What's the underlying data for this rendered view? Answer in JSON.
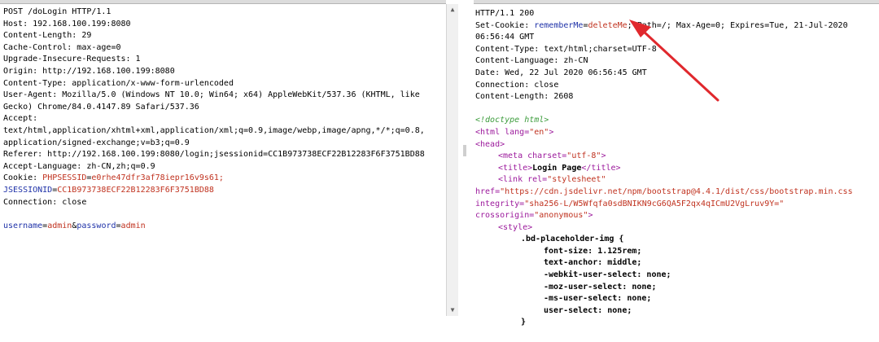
{
  "request": {
    "lines": [
      "POST /doLogin HTTP/1.1",
      "Host: 192.168.100.199:8080",
      "Content-Length: 29",
      "Cache-Control: max-age=0",
      "Upgrade-Insecure-Requests: 1",
      "Origin: http://192.168.100.199:8080",
      "Content-Type: application/x-www-form-urlencoded",
      "User-Agent: Mozilla/5.0 (Windows NT 10.0; Win64; x64) AppleWebKit/537.36 (KHTML, like",
      "Gecko) Chrome/84.0.4147.89 Safari/537.36",
      "Accept:",
      "text/html,application/xhtml+xml,application/xml;q=0.9,image/webp,image/apng,*/*;q=0.8,",
      "application/signed-exchange;v=b3;q=0.9",
      "Referer: http://192.168.100.199:8080/login;jsessionid=CC1B973738ECF22B12283F6F3751BD88",
      "Accept-Language: zh-CN,zh;q=0.9"
    ],
    "cookie_label": "Cookie: ",
    "cookie1_name": "PHPSESSID",
    "cookie1_eq": "=",
    "cookie1_value": "e0rhe47dfr3af78iepr16v9s61;",
    "cookie2_name": "JSESSIONID",
    "cookie2_eq": "=",
    "cookie2_value": "CC1B973738ECF22B12283F6F3751BD88",
    "connection": "Connection: close",
    "body_user_key": "username",
    "body_eq1": "=",
    "body_user_val": "admin",
    "body_amp": "&",
    "body_pass_key": "password",
    "body_eq2": "=",
    "body_pass_val": "admin"
  },
  "response": {
    "status": "HTTP/1.1 200",
    "setcookie_label": "Set-Cookie: ",
    "setcookie_name": "rememberMe",
    "setcookie_eq": "=",
    "setcookie_value": "deleteMe",
    "setcookie_rest": "; Path=/; Max-Age=0; Expires=Tue, 21-Jul-2020",
    "setcookie_time": "06:56:44 GMT",
    "content_type": "Content-Type: text/html;charset=UTF-8",
    "content_language": "Content-Language: zh-CN",
    "date": "Date: Wed, 22 Jul 2020 06:56:45 GMT",
    "connection": "Connection: close",
    "content_length": "Content-Length: 2608",
    "doctype": "<!doctype html>",
    "html_open": "<html ",
    "html_lang_attr": "lang=",
    "html_lang_val": "\"en\"",
    "html_close": ">",
    "head": "<head>",
    "meta_open": "<meta ",
    "meta_attr": "charset=",
    "meta_val": "\"utf-8\"",
    "meta_close": ">",
    "title_open": "<title>",
    "title_text": "Login Page",
    "title_close": "</title>",
    "link_open": "<link ",
    "link_attr": "rel=",
    "link_val": "\"stylesheet\"",
    "href_attr": "href=",
    "href_val": "\"https://cdn.jsdelivr.net/npm/bootstrap@4.4.1/dist/css/bootstrap.min.css",
    "integrity_attr": "integrity=",
    "integrity_val": "\"sha256-L/W5Wfqfa0sdBNIKN9cG6QA5F2qx4qICmU2VgLruv9Y=\"",
    "crossorigin_attr": "crossorigin=",
    "crossorigin_val": "\"anonymous\"",
    "crossorigin_close": ">",
    "style_open": "<style>",
    "css_selector": ".bd-placeholder-img {",
    "css_props": [
      "font-size: 1.125rem;",
      "text-anchor: middle;",
      "-webkit-user-select: none;",
      "-moz-user-select: none;",
      "-ms-user-select: none;",
      "user-select: none;"
    ],
    "css_close": "}"
  },
  "ui": {
    "scroll_up_icon": "▲",
    "scroll_down_icon": "▼",
    "arrow_color": "#e0282d"
  }
}
